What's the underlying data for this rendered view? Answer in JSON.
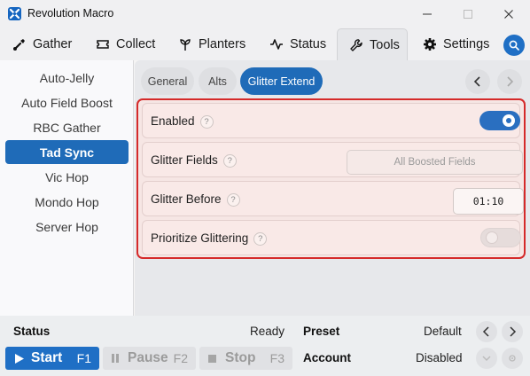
{
  "window": {
    "title": "Revolution Macro"
  },
  "nav": {
    "tabs": [
      {
        "label": "Gather",
        "icon": "shovel-icon"
      },
      {
        "label": "Collect",
        "icon": "ticket-icon"
      },
      {
        "label": "Planters",
        "icon": "sprout-icon"
      },
      {
        "label": "Status",
        "icon": "activity-icon"
      },
      {
        "label": "Tools",
        "icon": "wrench-icon",
        "active": true
      },
      {
        "label": "Settings",
        "icon": "gear-icon"
      }
    ]
  },
  "sidebar": {
    "items": [
      {
        "label": "Auto-Jelly"
      },
      {
        "label": "Auto Field Boost"
      },
      {
        "label": "RBC Gather"
      },
      {
        "label": "Tad Sync",
        "active": true
      },
      {
        "label": "Vic Hop"
      },
      {
        "label": "Mondo Hop"
      },
      {
        "label": "Server Hop"
      }
    ]
  },
  "subtabs": [
    {
      "label": "General"
    },
    {
      "label": "Alts"
    },
    {
      "label": "Glitter Extend",
      "active": true
    }
  ],
  "settings": {
    "enabled": {
      "label": "Enabled",
      "help": "?",
      "value": true
    },
    "glitter_fields": {
      "label": "Glitter Fields",
      "help": "?",
      "value": "All Boosted Fields"
    },
    "glitter_before": {
      "label": "Glitter Before",
      "help": "?",
      "value": "01:10"
    },
    "prioritize": {
      "label": "Prioritize Glittering",
      "help": "?",
      "value": false
    }
  },
  "footer": {
    "status_label": "Status",
    "status_value": "Ready",
    "preset_label": "Preset",
    "preset_value": "Default",
    "account_label": "Account",
    "account_value": "Disabled",
    "start_label": "Start",
    "start_key": "F1",
    "pause_label": "Pause",
    "pause_key": "F2",
    "stop_label": "Stop",
    "stop_key": "F3"
  },
  "colors": {
    "accent": "#1f6bb8",
    "highlight_border": "#d52a2a"
  }
}
